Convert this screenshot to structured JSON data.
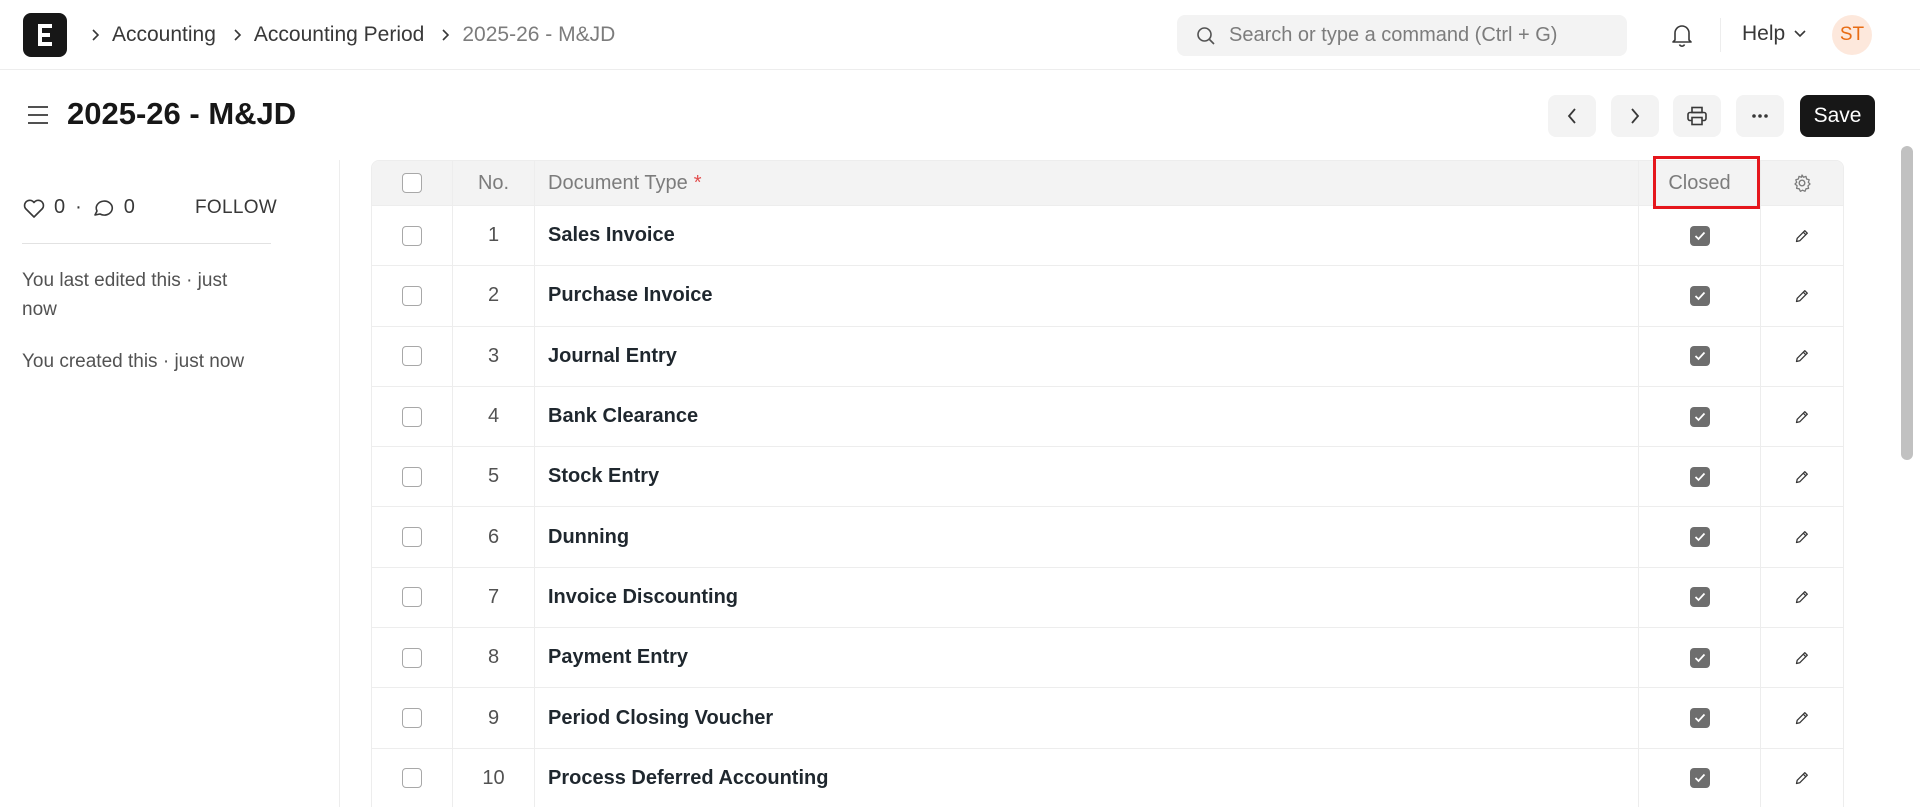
{
  "navbar": {
    "logo_letter": "E",
    "breadcrumbs": [
      "Accounting",
      "Accounting Period",
      "2025-26 - M&JD"
    ],
    "search_placeholder": "Search or type a command (Ctrl + G)",
    "help_label": "Help",
    "avatar_initials": "ST"
  },
  "page": {
    "title": "2025-26 - M&JD",
    "save_label": "Save"
  },
  "sidebar": {
    "likes": "0",
    "comments": "0",
    "separator": "·",
    "follow_label": "FOLLOW",
    "last_edited": "You last edited this · just now",
    "created": "You created this · just now"
  },
  "table": {
    "headers": {
      "no": "No.",
      "document_type": "Document Type",
      "required_mark": "*",
      "closed": "Closed"
    },
    "rows": [
      {
        "no": "1",
        "document_type": "Sales Invoice",
        "closed": true
      },
      {
        "no": "2",
        "document_type": "Purchase Invoice",
        "closed": true
      },
      {
        "no": "3",
        "document_type": "Journal Entry",
        "closed": true
      },
      {
        "no": "4",
        "document_type": "Bank Clearance",
        "closed": true
      },
      {
        "no": "5",
        "document_type": "Stock Entry",
        "closed": true
      },
      {
        "no": "6",
        "document_type": "Dunning",
        "closed": true
      },
      {
        "no": "7",
        "document_type": "Invoice Discounting",
        "closed": true
      },
      {
        "no": "8",
        "document_type": "Payment Entry",
        "closed": true
      },
      {
        "no": "9",
        "document_type": "Period Closing Voucher",
        "closed": true
      },
      {
        "no": "10",
        "document_type": "Process Deferred Accounting",
        "closed": true
      }
    ]
  },
  "colors": {
    "accent": "#171717",
    "highlight": "#e5161c",
    "avatar_bg": "#fde8dc",
    "avatar_fg": "#e86c13"
  },
  "icons": [
    "search-icon",
    "bell-icon",
    "chevron-down-icon",
    "hamburger-icon",
    "chevron-left-icon",
    "chevron-right-icon",
    "printer-icon",
    "more-icon",
    "heart-icon",
    "comment-icon",
    "gear-icon",
    "pencil-icon",
    "check-icon"
  ]
}
